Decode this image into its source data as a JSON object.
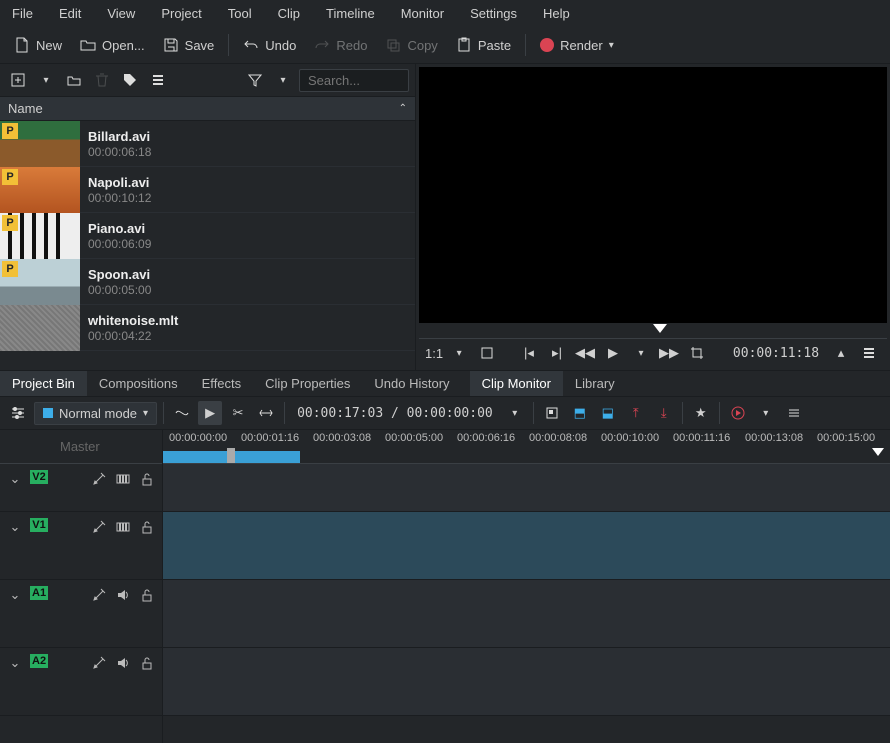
{
  "menu": {
    "items": [
      "File",
      "Edit",
      "View",
      "Project",
      "Tool",
      "Clip",
      "Timeline",
      "Monitor",
      "Settings",
      "Help"
    ]
  },
  "toolbar": {
    "new": "New",
    "open": "Open...",
    "save": "Save",
    "undo": "Undo",
    "redo": "Redo",
    "copy": "Copy",
    "paste": "Paste",
    "render": "Render"
  },
  "bin": {
    "search_placeholder": "Search...",
    "header": "Name",
    "items": [
      {
        "name": "Billard.avi",
        "dur": "00:00:06:18",
        "badge": "P",
        "thumb": "th-billard"
      },
      {
        "name": "Napoli.avi",
        "dur": "00:00:10:12",
        "badge": "P",
        "thumb": "th-napoli"
      },
      {
        "name": "Piano.avi",
        "dur": "00:00:06:09",
        "badge": "P",
        "thumb": "th-piano"
      },
      {
        "name": "Spoon.avi",
        "dur": "00:00:05:00",
        "badge": "P",
        "thumb": "th-spoon"
      },
      {
        "name": "whitenoise.mlt",
        "dur": "00:00:04:22",
        "badge": "",
        "thumb": "th-noise"
      }
    ]
  },
  "tabs_left": [
    "Project Bin",
    "Compositions",
    "Effects",
    "Clip Properties",
    "Undo History"
  ],
  "tabs_right": [
    "Clip Monitor",
    "Library"
  ],
  "monitor": {
    "scale": "1:1",
    "tc": "00:00:11:18"
  },
  "timeline": {
    "mode": "Normal mode",
    "tc": "00:00:17:03 / 00:00:00:00",
    "master": "Master",
    "ruler": [
      "00:00:00:00",
      "00:00:01:16",
      "00:00:03:08",
      "00:00:05:00",
      "00:00:06:16",
      "00:00:08:08",
      "00:00:10:00",
      "00:00:11:16",
      "00:00:13:08",
      "00:00:15:00"
    ],
    "tracks": [
      {
        "tag": "V2",
        "type": "video",
        "size": "short"
      },
      {
        "tag": "V1",
        "type": "video",
        "size": "tall"
      },
      {
        "tag": "A1",
        "type": "audio",
        "size": "tall"
      },
      {
        "tag": "A2",
        "type": "audio",
        "size": "tall"
      }
    ]
  }
}
